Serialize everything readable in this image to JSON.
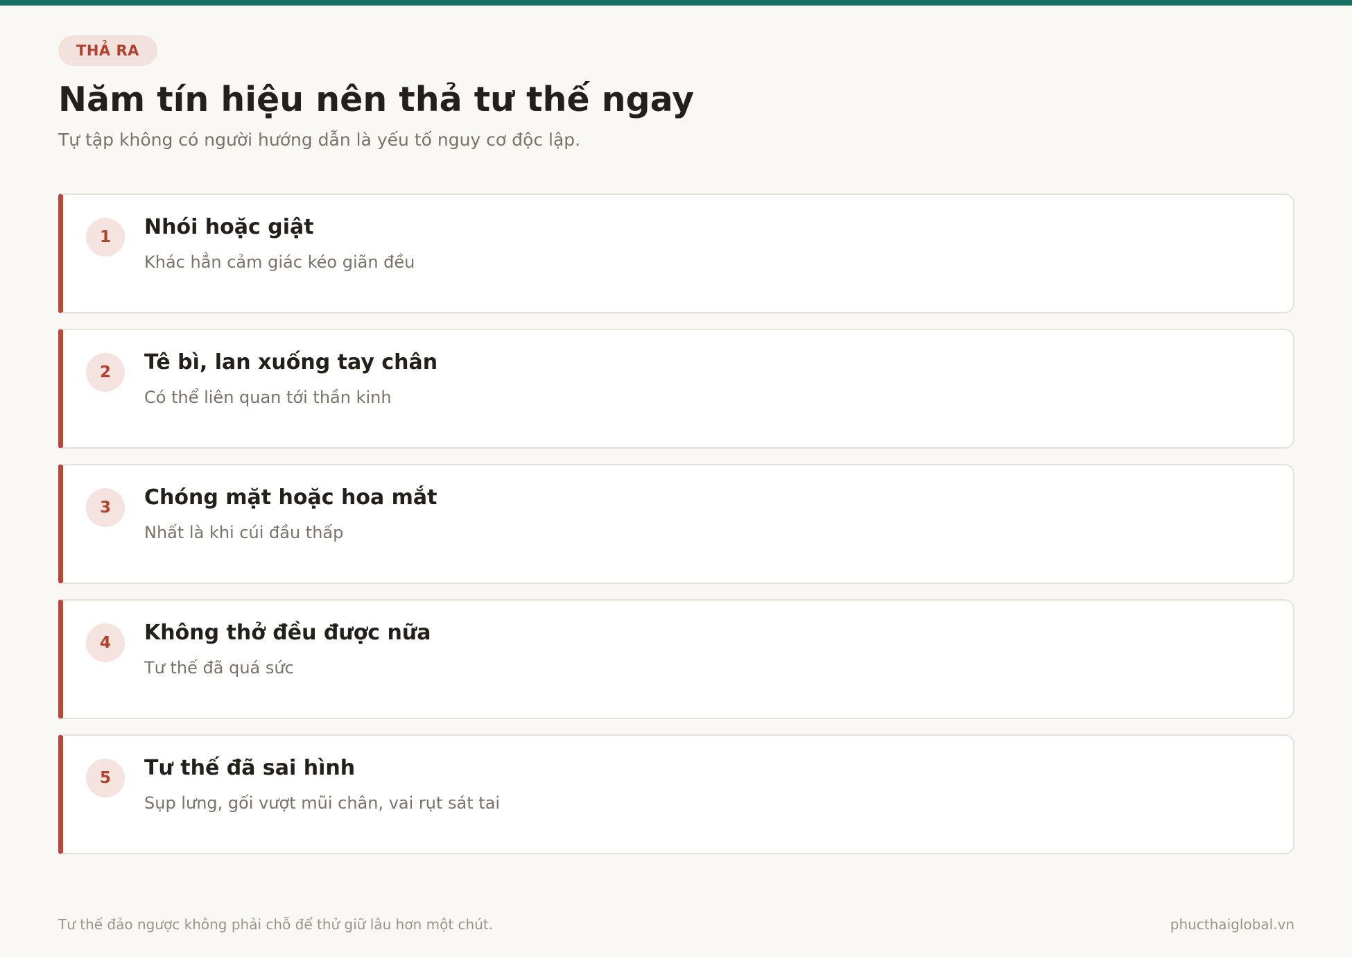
{
  "header": {
    "tag": "THẢ RA",
    "title": "Năm tín hiệu nên thả tư thế ngay",
    "subtitle": "Tự tập không có người hướng dẫn là yếu tố nguy cơ độc lập."
  },
  "signals": [
    {
      "number": "1",
      "title": "Nhói hoặc giật",
      "description": "Khác hẳn cảm giác kéo giãn đều"
    },
    {
      "number": "2",
      "title": "Tê bì, lan xuống tay chân",
      "description": "Có thể liên quan tới thần kinh"
    },
    {
      "number": "3",
      "title": "Chóng mặt hoặc hoa mắt",
      "description": "Nhất là khi cúi đầu thấp"
    },
    {
      "number": "4",
      "title": "Không thở đều được nữa",
      "description": "Tư thế đã quá sức"
    },
    {
      "number": "5",
      "title": "Tư thế đã sai hình",
      "description": "Sụp lưng, gối vượt mũi chân, vai rụt sát tai"
    }
  ],
  "footer": {
    "note": "Tư thế đảo ngược không phải chỗ để thử giữ lâu hơn một chút.",
    "site": "phucthaiglobal.vn"
  },
  "colors": {
    "top_bar": "#177163",
    "accent": "#b9483a",
    "background": "#f9f8f5"
  }
}
